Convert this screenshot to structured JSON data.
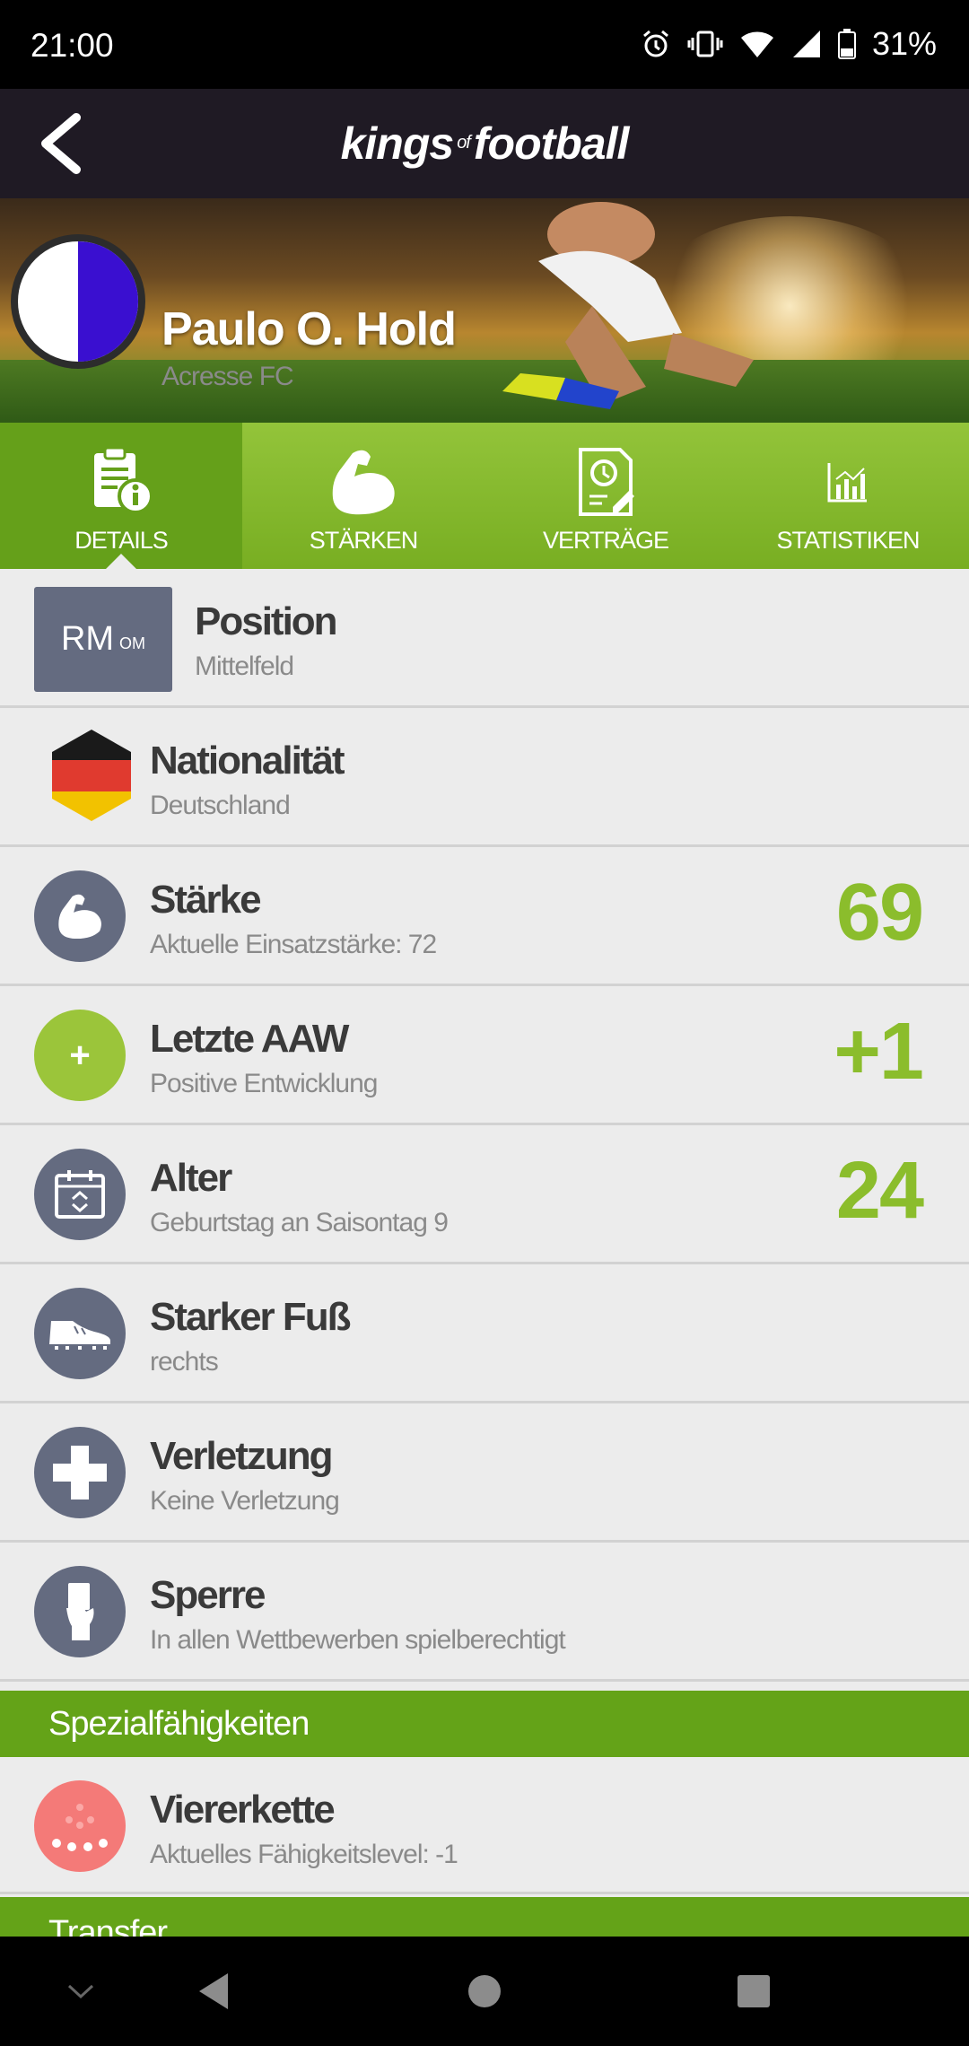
{
  "status_bar": {
    "time": "21:00",
    "battery": "31%"
  },
  "app_bar": {
    "logo_kings": "kings",
    "logo_of": "of",
    "logo_football": "football"
  },
  "player": {
    "name": "Paulo O. Hold",
    "club": "Acresse FC"
  },
  "tabs": [
    {
      "label": "DETAILS",
      "icon": "document-info-icon",
      "active": true
    },
    {
      "label": "STÄRKEN",
      "icon": "muscle-icon",
      "active": false
    },
    {
      "label": "VERTRÄGE",
      "icon": "contract-clock-icon",
      "active": false
    },
    {
      "label": "STATISTIKEN",
      "icon": "bar-chart-icon",
      "active": false
    }
  ],
  "rows": {
    "position": {
      "badge_main": "RM",
      "badge_secondary": "OM",
      "title": "Position",
      "sub": "Mittelfeld"
    },
    "nationality": {
      "title": "Nationalität",
      "sub": "Deutschland",
      "flag_colors": [
        "#1a1a1a",
        "#e03a2f",
        "#f2c200"
      ]
    },
    "strength": {
      "title": "Stärke",
      "sub": "Aktuelle Einsatzstärke: 72",
      "value": "69",
      "icon": "muscle-icon"
    },
    "last_aaw": {
      "title": "Letzte AAW",
      "sub": "Positive Entwicklung",
      "value": "+1",
      "icon_text": "+",
      "icon": "plus-icon"
    },
    "age": {
      "title": "Alter",
      "sub": "Geburtstag an Saisontag 9",
      "value": "24",
      "icon": "calendar-icon"
    },
    "strong_foot": {
      "title": "Starker Fuß",
      "sub": "rechts",
      "icon": "boot-icon"
    },
    "injury": {
      "title": "Verletzung",
      "sub": "Keine Verletzung",
      "icon": "medical-cross-icon"
    },
    "suspension": {
      "title": "Sperre",
      "sub": "In allen Wettbewerben spielberechtigt",
      "icon": "referee-card-icon"
    }
  },
  "special_section": {
    "header": "Spezialfähigkeiten"
  },
  "special_rows": {
    "viererkette": {
      "title": "Viererkette",
      "sub": "Aktuelles Fähigkeitslevel: -1",
      "icon": "dots-icon"
    }
  },
  "transfer_section": {
    "header": "Transfer"
  },
  "colors": {
    "accent_green": "#8bbd2c",
    "header_green": "#64a318",
    "icon_grey": "#646b80",
    "app_bar": "#1f1a24"
  }
}
